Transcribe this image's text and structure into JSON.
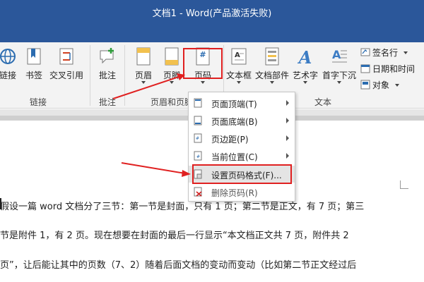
{
  "window": {
    "title": "文档1 - Word(产品激活失败)"
  },
  "ribbon": {
    "links_group": {
      "label": "链接",
      "buttons": [
        {
          "name": "link",
          "label": "链接"
        },
        {
          "name": "bookmark",
          "label": "书签"
        },
        {
          "name": "cross-reference",
          "label": "交叉引用"
        }
      ]
    },
    "comments_group": {
      "label": "批注",
      "buttons": [
        {
          "name": "comment",
          "label": "批注"
        }
      ]
    },
    "header_footer_group": {
      "label": "页眉和页脚",
      "buttons": [
        {
          "name": "header",
          "label": "页眉"
        },
        {
          "name": "footer",
          "label": "页脚"
        },
        {
          "name": "page-number",
          "label": "页码"
        }
      ]
    },
    "text_group": {
      "label": "文本",
      "buttons": [
        {
          "name": "textbox",
          "label": "文本框"
        },
        {
          "name": "quick-parts",
          "label": "文档部件"
        },
        {
          "name": "wordart",
          "label": "艺术字"
        },
        {
          "name": "drop-cap",
          "label": "首字下沉"
        }
      ],
      "small_items": [
        {
          "name": "signature-line",
          "label": "签名行"
        },
        {
          "name": "date-time",
          "label": "日期和时间"
        },
        {
          "name": "object",
          "label": "对象"
        }
      ]
    }
  },
  "page_number_menu": {
    "items": [
      {
        "label": "页面顶端(T)",
        "has_submenu": true
      },
      {
        "label": "页面底端(B)",
        "has_submenu": true
      },
      {
        "label": "页边距(P)",
        "has_submenu": true
      },
      {
        "label": "当前位置(C)",
        "has_submenu": true
      },
      {
        "label": "设置页码格式(F)...",
        "has_submenu": false,
        "selected": true
      },
      {
        "label": "删除页码(R)",
        "has_submenu": false
      }
    ]
  },
  "document": {
    "lines": [
      "假设一篇 word 文档分了三节：第一节是封面，只有 1 页；第二节是正文，有 7 页；第三",
      "节是附件 1，有 2 页。现在想要在封面的最后一行显示“本文档正文共 7 页，附件共 2",
      "页”，让后能让其中的页数（7、2）随着后面文档的变动而变动（比如第二节正文经过后"
    ]
  },
  "colors": {
    "title_bar": "#2b579a",
    "ribbon_bg": "#f3f3f3",
    "annotation_red": "#e02020",
    "selected_item_bg": "#e4e4e4"
  }
}
